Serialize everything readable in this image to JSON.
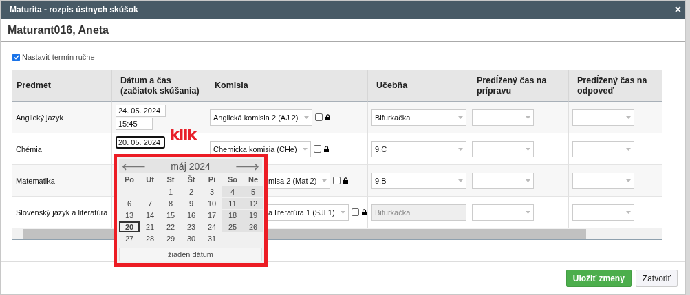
{
  "window": {
    "title": "Maturita - rozpis ústnych skúšok",
    "close": "×"
  },
  "student": "Maturant016, Aneta",
  "manual_term": {
    "label": "Nastaviť termín ručne",
    "checked": true
  },
  "table": {
    "columns": [
      {
        "label": "Predmet"
      },
      {
        "label": "Dátum a čas (začiatok skúšania)"
      },
      {
        "label": "Komisia"
      },
      {
        "label": "Učebňa"
      },
      {
        "label": "Predĺžený čas na prípravu"
      },
      {
        "label": "Predĺžený čas na odpoveď"
      }
    ],
    "rows": [
      {
        "subject": "Anglický jazyk",
        "date": "24. 05. 2024",
        "time": "15:45",
        "focused": false,
        "committee": "Anglická komisia 2 (AJ 2)",
        "committee_covered": false,
        "checked": false,
        "room": "Bifurkačka",
        "room_disabled": false
      },
      {
        "subject": "Chémia",
        "date": "20. 05. 2024",
        "focused": true,
        "committee": "Chemicka komisia (CHe)",
        "committee_covered": false,
        "checked": false,
        "room": "9.C",
        "room_disabled": false
      },
      {
        "subject": "Matematika",
        "committee": "misa 2 (Mat 2)",
        "committee_covered": true,
        "checked": false,
        "room": "9.B",
        "room_disabled": false
      },
      {
        "subject": "Slovenský jazyk a literatúra",
        "committee": "a literatúra 1 (SJL1)",
        "committee_covered": true,
        "checked": false,
        "room": "Bifurkačka",
        "room_disabled": true
      }
    ]
  },
  "calendar": {
    "prev": "🡐",
    "next": "🡒",
    "month": "máj 2024",
    "weekdays": [
      "Po",
      "Ut",
      "St",
      "Št",
      "Pi",
      "So",
      "Ne"
    ],
    "weeks": [
      {
        "kind": "first",
        "days": [
          {
            "day": "1",
            "selected": false
          },
          {
            "day": "2",
            "selected": false
          },
          {
            "day": "3",
            "selected": false
          },
          {
            "day": "4",
            "selected": false
          },
          {
            "day": "5",
            "selected": false
          }
        ]
      },
      {
        "kind": "full",
        "days": [
          {
            "day": "6",
            "selected": false
          },
          {
            "day": "7",
            "selected": false
          },
          {
            "day": "8",
            "selected": false
          },
          {
            "day": "9",
            "selected": false
          },
          {
            "day": "10",
            "selected": false
          },
          {
            "day": "11",
            "selected": false
          },
          {
            "day": "12",
            "selected": false
          }
        ]
      },
      {
        "kind": "full",
        "days": [
          {
            "day": "13",
            "selected": false
          },
          {
            "day": "14",
            "selected": false
          },
          {
            "day": "15",
            "selected": false
          },
          {
            "day": "16",
            "selected": false
          },
          {
            "day": "17",
            "selected": false
          },
          {
            "day": "18",
            "selected": false
          },
          {
            "day": "19",
            "selected": false
          }
        ]
      },
      {
        "kind": "full",
        "days": [
          {
            "day": "20",
            "selected": true
          },
          {
            "day": "21",
            "selected": false
          },
          {
            "day": "22",
            "selected": false
          },
          {
            "day": "23",
            "selected": false
          },
          {
            "day": "24",
            "selected": false
          },
          {
            "day": "25",
            "selected": false
          },
          {
            "day": "26",
            "selected": false
          }
        ]
      },
      {
        "kind": "last",
        "days": [
          {
            "day": "27",
            "selected": false
          },
          {
            "day": "28",
            "selected": false
          },
          {
            "day": "29",
            "selected": false
          },
          {
            "day": "30",
            "selected": false
          },
          {
            "day": "31",
            "selected": false
          }
        ]
      }
    ],
    "clear": "žiaden dátum"
  },
  "annotation": "klik",
  "buttons": [
    {
      "label": "Uložiť zmeny",
      "kind": "primary"
    },
    {
      "label": "Zatvoriť",
      "kind": "secondary"
    }
  ]
}
